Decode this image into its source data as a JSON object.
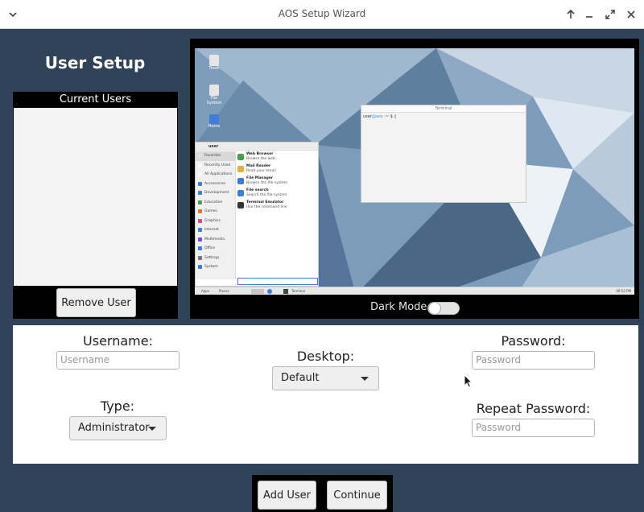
{
  "window": {
    "title": "AOS Setup Wizard",
    "menu_icon": "chevron-down-icon",
    "controls": [
      "arrow-up-icon",
      "minimize-icon",
      "maximize-icon",
      "close-icon"
    ]
  },
  "left": {
    "heading": "User Setup",
    "users_header": "Current Users",
    "users": [],
    "remove_button": "Remove User"
  },
  "preview": {
    "dark_mode_label": "Dark Mode",
    "dark_mode_on": false,
    "desktop_icons": [
      "Trash",
      "File System",
      "Home"
    ],
    "terminal_title": "Terminal",
    "terminal_prompt_user": "user",
    "terminal_prompt_host": "@aos",
    "terminal_prompt_rest": ":~ $",
    "menu_user": "user",
    "menu_categories": [
      "Favorites",
      "Recently Used",
      "All Applications",
      "Accessories",
      "Development",
      "Education",
      "Games",
      "Graphics",
      "Internet",
      "Multimedia",
      "Office",
      "Settings",
      "System"
    ],
    "menu_apps": [
      {
        "name": "Web Browser",
        "desc": "Browse the web"
      },
      {
        "name": "Mail Reader",
        "desc": "Read your email"
      },
      {
        "name": "File Manager",
        "desc": "Browse the file system"
      },
      {
        "name": "File search",
        "desc": "Search the file system"
      },
      {
        "name": "Terminal Emulator",
        "desc": "Use the command line"
      }
    ],
    "taskbar_items": [
      "Apps",
      "Places",
      "Terminal"
    ],
    "clock": "06:52 PM"
  },
  "form": {
    "username_label": "Username:",
    "username_placeholder": "Username",
    "username_value": "",
    "desktop_label": "Desktop:",
    "desktop_value": "Default",
    "password_label": "Password:",
    "password_placeholder": "Password",
    "type_label": "Type:",
    "type_value": "Administrator",
    "repeat_label": "Repeat Password:",
    "repeat_placeholder": "Password"
  },
  "actions": {
    "add_user": "Add User",
    "continue": "Continue"
  },
  "colors": {
    "background": "#2f4358",
    "panel": "#000000",
    "form": "#ffffff",
    "button": "#efefef"
  }
}
